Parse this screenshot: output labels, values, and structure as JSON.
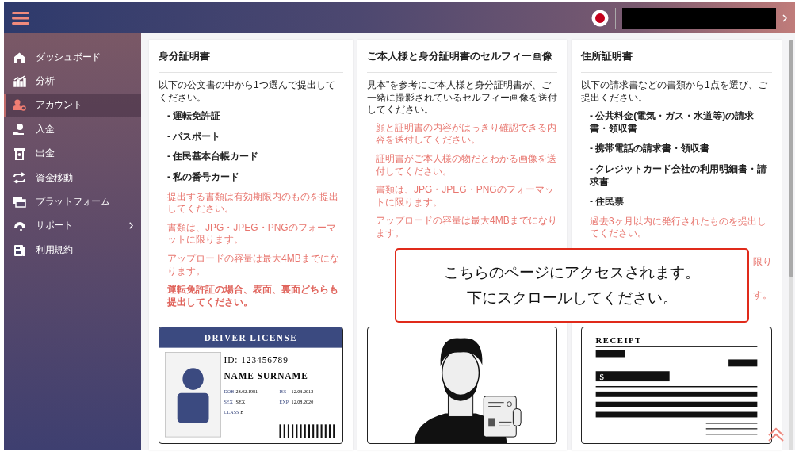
{
  "sidebar": {
    "items": [
      {
        "label": "ダッシュボード",
        "selected": false,
        "expandable": false
      },
      {
        "label": "分析",
        "selected": false,
        "expandable": false
      },
      {
        "label": "アカウント",
        "selected": true,
        "expandable": false
      },
      {
        "label": "入金",
        "selected": false,
        "expandable": false
      },
      {
        "label": "出金",
        "selected": false,
        "expandable": false
      },
      {
        "label": "資金移動",
        "selected": false,
        "expandable": false
      },
      {
        "label": "プラットフォーム",
        "selected": false,
        "expandable": false
      },
      {
        "label": "サポート",
        "selected": false,
        "expandable": true
      },
      {
        "label": "利用規約",
        "selected": false,
        "expandable": false
      }
    ]
  },
  "cards": [
    {
      "title": "身分証明書",
      "intro": "以下の公文書の中から1つ選んで提出してください。",
      "items": [
        "- 運転免許証",
        "- パスポート",
        "- 住民基本台帳カード",
        "- 私の番号カード"
      ],
      "notes": [
        {
          "text": "提出する書類は有効期限内のものを提出してください。",
          "emphasis": false
        },
        {
          "text": "書類は、JPG・JPEG・PNGのフォーマットに限ります。",
          "emphasis": false
        },
        {
          "text": "アップロードの容量は最大4MBまでになります。",
          "emphasis": false
        },
        {
          "text": "運転免許証の場合、表面、裏面どちらも提出してください。",
          "emphasis": true
        }
      ],
      "illustration": {
        "kind": "license",
        "title": "DRIVER LICENSE",
        "id": "ID: 123456789",
        "name": "NAME SURNAME",
        "fields": [
          {
            "label": "DOB",
            "value": "23.02.1981"
          },
          {
            "label": "ISS",
            "value": "12.03.2012"
          },
          {
            "label": "SEX",
            "value": "SEX"
          },
          {
            "label": "EXP",
            "value": "12.08.2020"
          },
          {
            "label": "CLASS",
            "value": "B"
          }
        ]
      }
    },
    {
      "title": "ご本人様と身分証明書のセルフィー画像",
      "intro": "見本\"を参考にご本人様と身分証明書が、ご一緒に撮影されているセルフィー画像を送付してください。",
      "notes": [
        {
          "text": "顔と証明書の内容がはっきり確認できる内容を送付してください。",
          "emphasis": false
        },
        {
          "text": "証明書がご本人様の物だとわかる画像を送付してください。",
          "emphasis": false
        },
        {
          "text": "書類は、JPG・JPEG・PNGのフォーマットに限ります。",
          "emphasis": false
        },
        {
          "text": "アップロードの容量は最大4MBまでになります。",
          "emphasis": false
        }
      ],
      "illustration": {
        "kind": "selfie"
      }
    },
    {
      "title": "住所証明書",
      "intro": "以下の請求書などの書類から1点を選び、ご提出ください。",
      "items": [
        "- 公共料金(電気・ガス・水道等)の請求書・領収書",
        "- 携帯電話の請求書・領収書",
        "- クレジットカード会社の利用明細書・請求書",
        "- 住民票"
      ],
      "notes": [
        {
          "text": "過去3ヶ月以内に発行されたものを提出してください。",
          "emphasis": false
        }
      ],
      "covered_note_ends": [
        "限り",
        "す。"
      ],
      "illustration": {
        "kind": "receipt",
        "title": "RECEIPT",
        "amount_label": "$"
      }
    }
  ],
  "notice": {
    "lines": [
      "こちらのページにアクセスされます。",
      "下にスクロールしてください。"
    ]
  }
}
